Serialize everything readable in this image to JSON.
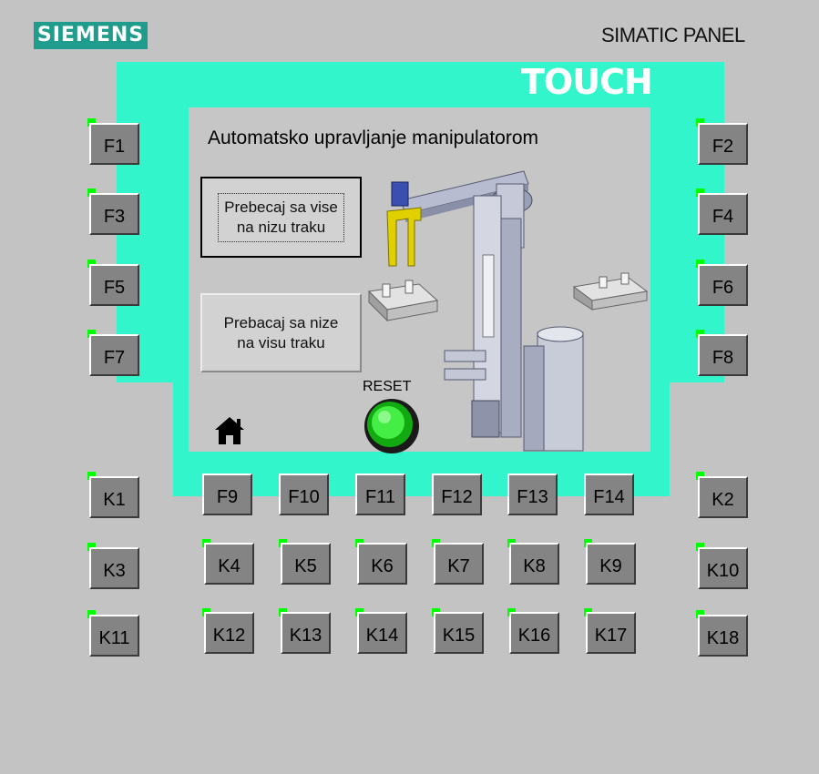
{
  "brand": "SIEMENS",
  "panel_model": "SIMATIC PANEL",
  "panel_type": "TOUCH",
  "screen": {
    "title": "Automatsko upravljanje manipulatorom",
    "btn_transfer_down": "Prebecaj sa vise\nna nizu traku",
    "btn_transfer_up": "Prebacaj sa nize\nna visu traku",
    "reset_label": "RESET",
    "home_icon": "home-icon"
  },
  "keys": {
    "left": [
      "F1",
      "F3",
      "F5",
      "F7"
    ],
    "right": [
      "F2",
      "F4",
      "F6",
      "F8"
    ],
    "bottom_f": [
      "F9",
      "F10",
      "F11",
      "F12",
      "F13",
      "F14"
    ],
    "row_k1": [
      "K1",
      "K4",
      "K5",
      "K6",
      "K7",
      "K8",
      "K9",
      "K2"
    ],
    "row_k2": [
      "K3",
      "K12",
      "K13",
      "K14",
      "K15",
      "K16",
      "K17",
      "K10"
    ],
    "row_k3": [
      "K11",
      "K18"
    ]
  },
  "colors": {
    "bezel_accent": "#33f5cc",
    "logo_bg": "#1f9c8c",
    "led": "#00ff00",
    "reset_button": "#22cc22"
  }
}
